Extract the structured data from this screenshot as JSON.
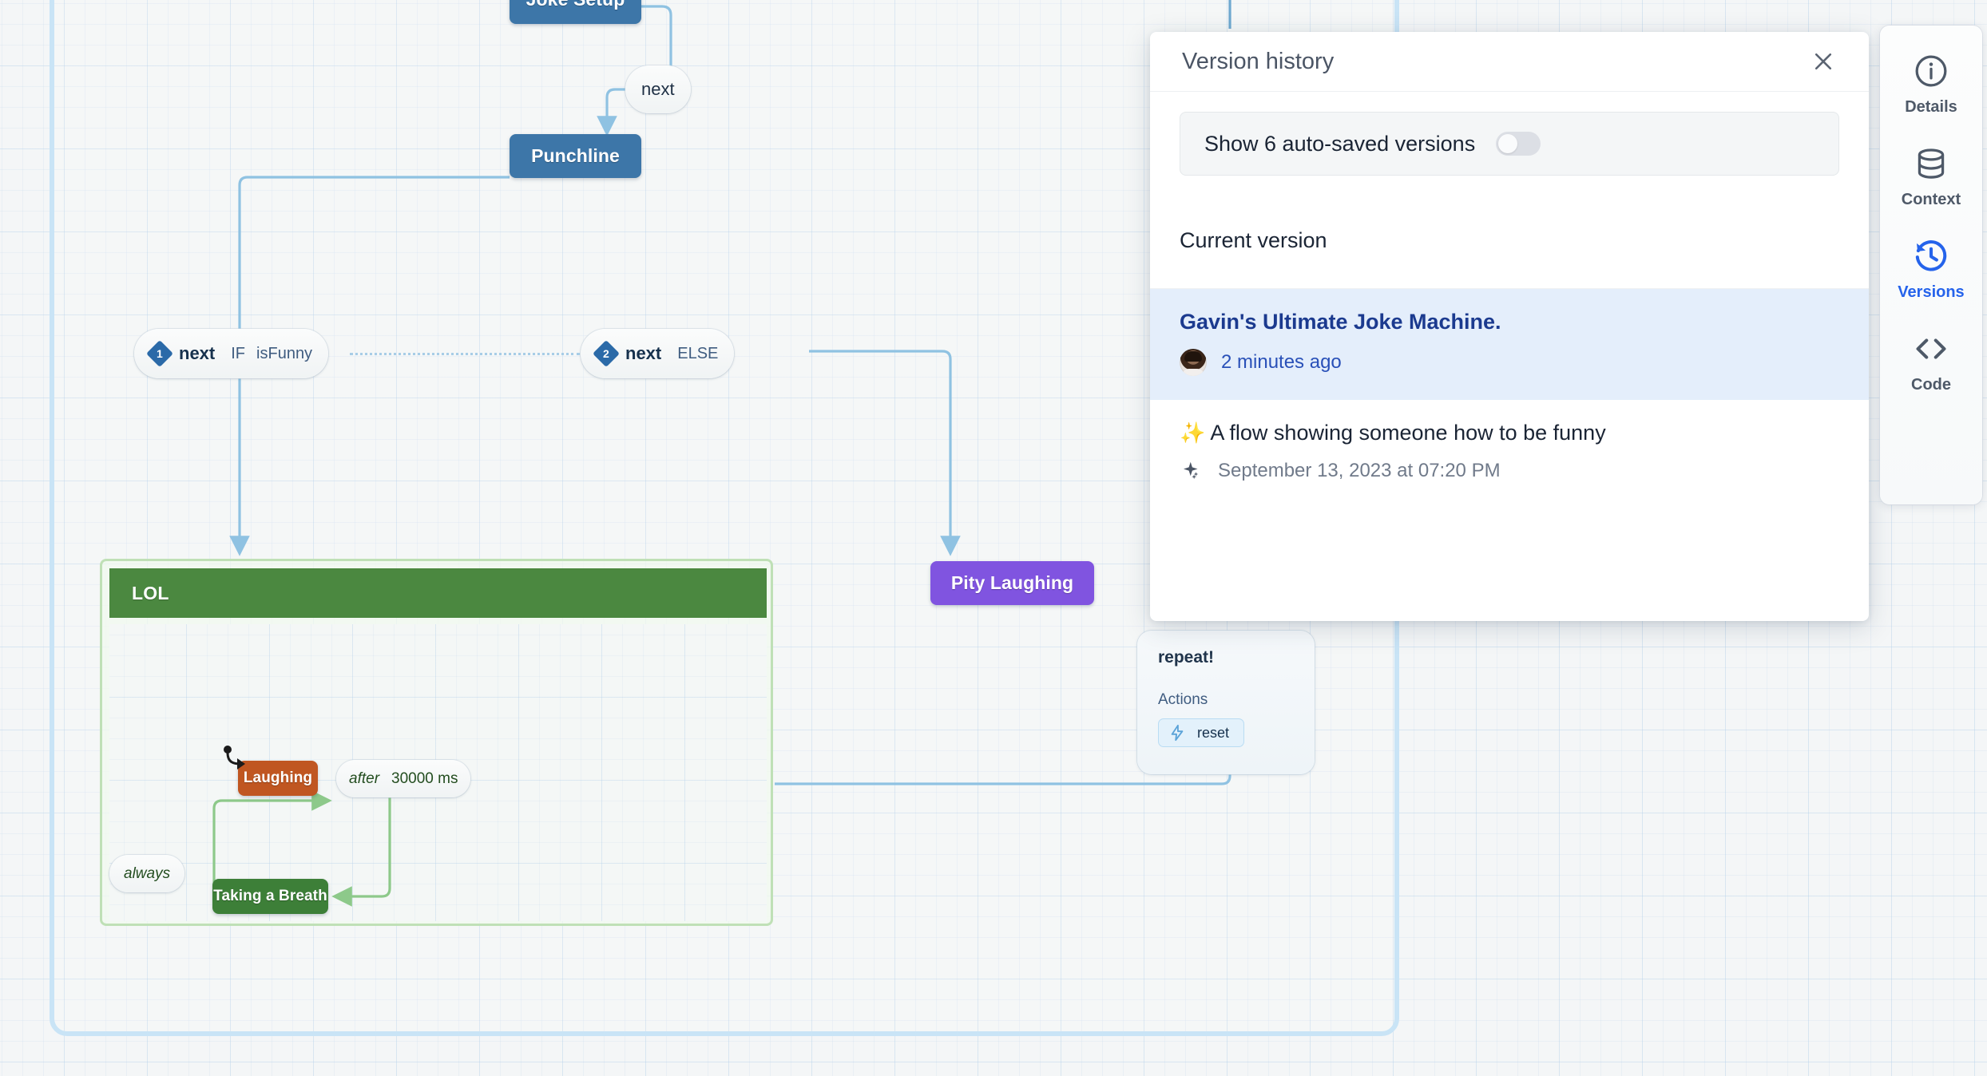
{
  "app": {
    "canvas_background": "#f4f6f7",
    "grid_color": "#b0cee9"
  },
  "flow": {
    "machine_name": "Joke Machine",
    "nodes": [
      {
        "id": "joke-setup",
        "label": "Joke Setup",
        "color": "#3d76a8",
        "type": "state"
      },
      {
        "id": "punchline",
        "label": "Punchline",
        "color": "#3d76a8",
        "type": "state"
      },
      {
        "id": "pity-laughing",
        "label": "Pity Laughing",
        "color": "#8054e0",
        "type": "state"
      },
      {
        "id": "laughing",
        "label": "Laughing",
        "color": "#c05621",
        "type": "state"
      },
      {
        "id": "taking-a-breath",
        "label": "Taking a Breath",
        "color": "#3d7f38",
        "type": "state"
      }
    ],
    "group": {
      "id": "lol",
      "label": "LOL",
      "header_color": "#4b8840",
      "border_color": "#bfe0b6"
    },
    "edge_labels": [
      {
        "id": "edge-next-top",
        "event": "next"
      },
      {
        "id": "edge-next-if",
        "index": "1",
        "event": "next",
        "guard_keyword": "IF",
        "guard": "isFunny"
      },
      {
        "id": "edge-next-else",
        "index": "2",
        "event": "next",
        "guard_keyword": "ELSE",
        "guard": ""
      },
      {
        "id": "edge-after-delay",
        "keyword": "after",
        "value": "30000 ms"
      },
      {
        "id": "edge-always",
        "keyword": "always"
      }
    ],
    "repeat_node": {
      "title": "repeat!",
      "actions_label": "Actions",
      "action_chip": "reset",
      "action_icon": "bolt-icon"
    }
  },
  "version_panel": {
    "title": "Version history",
    "close_icon": "close-icon",
    "autosave": {
      "label": "Show 6 auto-saved versions",
      "enabled": false
    },
    "current_version_label": "Current version",
    "versions": [
      {
        "name": "Gavin's Ultimate Joke Machine.",
        "time": "2 minutes ago",
        "avatar": "user-avatar",
        "selected": true,
        "prefix": ""
      },
      {
        "name": "A flow showing someone how to be funny",
        "time": "September 13, 2023 at 07:20 PM",
        "avatar": "ai-sparkle-icon",
        "selected": false,
        "prefix": "✨"
      }
    ]
  },
  "toolbar": {
    "items": [
      {
        "id": "details",
        "label": "Details",
        "icon": "info-circle-icon",
        "active": false
      },
      {
        "id": "context",
        "label": "Context",
        "icon": "database-icon",
        "active": false
      },
      {
        "id": "versions",
        "label": "Versions",
        "icon": "history-clock-icon",
        "active": true
      },
      {
        "id": "code",
        "label": "Code",
        "icon": "code-brackets-icon",
        "active": false
      }
    ],
    "active_color": "#2563eb",
    "inactive_color": "#4e5968"
  }
}
